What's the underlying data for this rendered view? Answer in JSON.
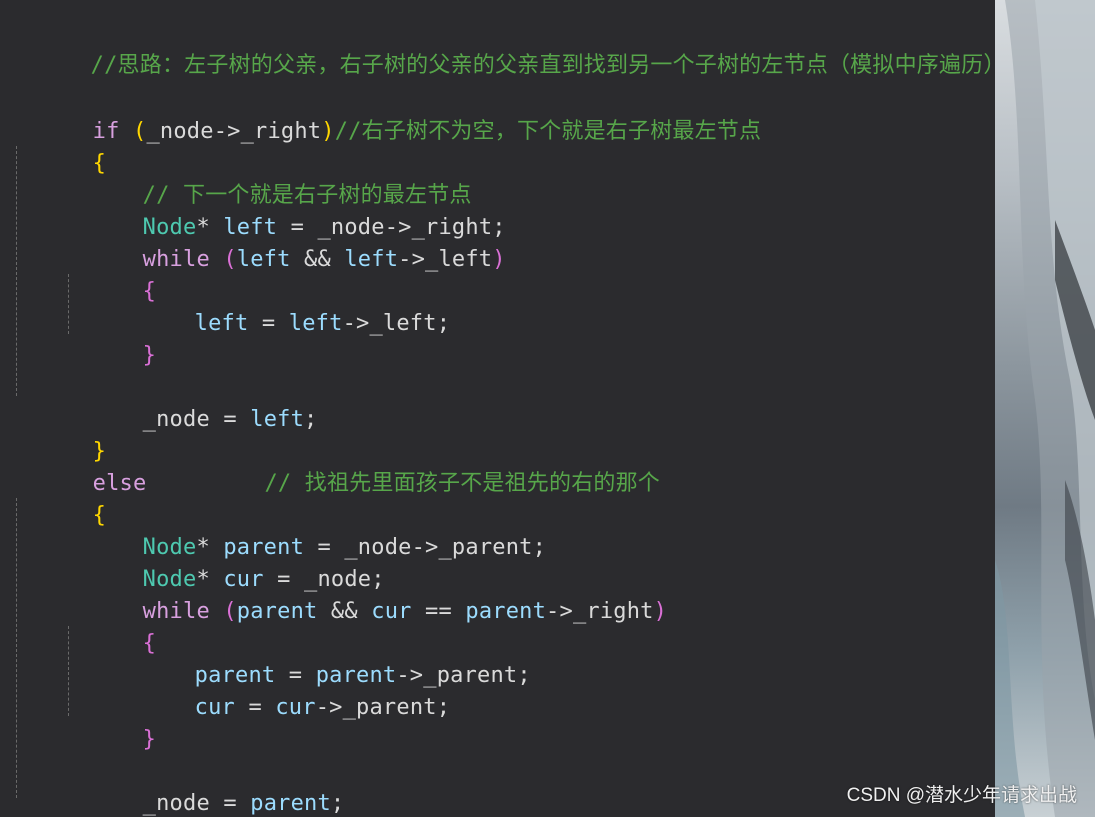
{
  "editor": {
    "lines": {
      "l1": {
        "comment": "//思路：左子树的父亲，右子树的父亲的父亲直到找到另一个子树的左节点（模拟中序遍历）"
      },
      "l3": {
        "kw": "if",
        "open": " (",
        "var": "_node",
        "arrow": "->",
        "member": "_right",
        "close": ")",
        "comment": "//右子树不为空，下个就是右子树最左节点"
      },
      "l4": {
        "brace": "{"
      },
      "l5": {
        "comment": "// 下一个就是右子树的最左节点"
      },
      "l6": {
        "type": "Node",
        "star": "* ",
        "var": "left",
        "eq": " = ",
        "src": "_node",
        "arrow": "->",
        "member": "_right",
        "end": ";"
      },
      "l7": {
        "kw": "while",
        "open": " (",
        "a": "left",
        "and": " && ",
        "b": "left",
        "arrow": "->",
        "member": "_left",
        "close": ")"
      },
      "l8": {
        "brace": "{"
      },
      "l9": {
        "var": "left",
        "eq": " = ",
        "src": "left",
        "arrow": "->",
        "member": "_left",
        "end": ";"
      },
      "l10": {
        "brace": "}"
      },
      "l12": {
        "var": "_node",
        "eq": " = ",
        "src": "left",
        "end": ";"
      },
      "l13": {
        "brace": "}"
      },
      "l14": {
        "kw": "else",
        "comment": "// 找祖先里面孩子不是祖先的右的那个"
      },
      "l15": {
        "brace": "{"
      },
      "l16": {
        "type": "Node",
        "star": "* ",
        "var": "parent",
        "eq": " = ",
        "src": "_node",
        "arrow": "->",
        "member": "_parent",
        "end": ";"
      },
      "l17": {
        "type": "Node",
        "star": "* ",
        "var": "cur",
        "eq": " = ",
        "src": "_node",
        "end": ";"
      },
      "l18": {
        "kw": "while",
        "open": " (",
        "a": "parent",
        "and": " && ",
        "b": "cur",
        "eqeq": " == ",
        "c": "parent",
        "arrow": "->",
        "member": "_right",
        "close": ")"
      },
      "l19": {
        "brace": "{"
      },
      "l20": {
        "var": "parent",
        "eq": " = ",
        "src": "parent",
        "arrow": "->",
        "member": "_parent",
        "end": ";"
      },
      "l21": {
        "var": "cur",
        "eq": " = ",
        "src": "cur",
        "arrow": "->",
        "member": "_parent",
        "end": ";"
      },
      "l22": {
        "brace": "}"
      },
      "l24": {
        "var": "_node",
        "eq": " = ",
        "src": "parent",
        "end": ";"
      },
      "l25": {
        "brace": "}"
      }
    }
  },
  "watermark": {
    "text": "CSDN @潜水少年请求出战"
  },
  "colors": {
    "background": "#2b2b2e",
    "comment": "#57a64a",
    "keyword": "#d8a0df",
    "type": "#4ec9b0",
    "identifier": "#9cdcfe",
    "plain": "#dadada"
  }
}
